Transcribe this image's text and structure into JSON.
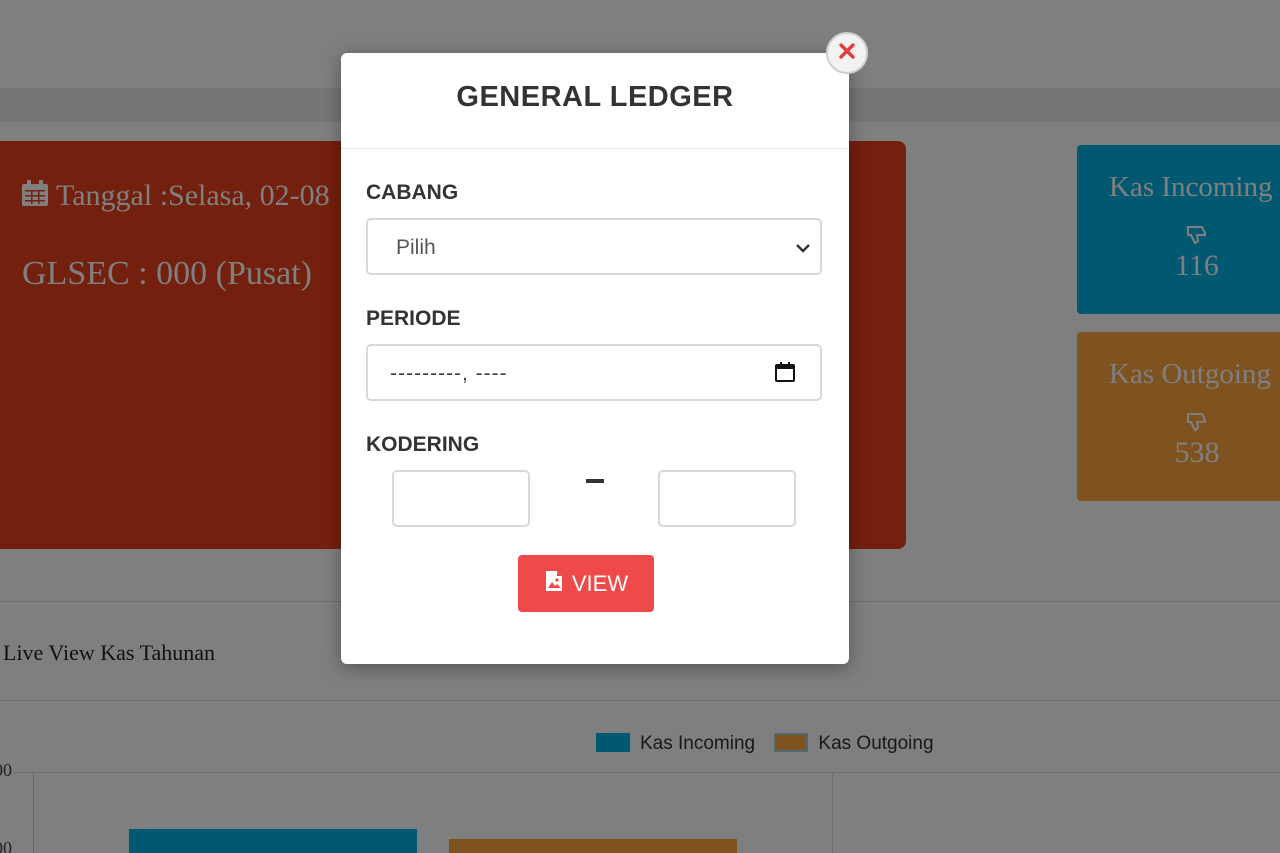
{
  "background": {
    "date_label": "Tanggal :Selasa, 02-08",
    "glsec_label": "GLSEC : 000 (Pusat)",
    "kas_incoming": {
      "title": "Kas Incoming",
      "value": "116"
    },
    "kas_outgoing": {
      "title": "Kas Outgoing",
      "value": "538"
    },
    "section_title": "Live View Kas Tahunan",
    "chart_data": {
      "type": "bar",
      "series": [
        {
          "name": "Kas Incoming",
          "color": "#00b3e3"
        },
        {
          "name": "Kas Outgoing",
          "color": "#ffa640"
        }
      ],
      "y_tick_labels": [
        "00",
        "00"
      ]
    },
    "colors": {
      "main_card": "#e8401c",
      "incoming": "#00b3e3",
      "outgoing": "#ffa640"
    }
  },
  "modal": {
    "title": "GENERAL LEDGER",
    "cabang_label": "CABANG",
    "cabang_value": "Pilih",
    "periode_label": "PERIODE",
    "periode_value": "---------, ----",
    "kodering_label": "KODERING",
    "view_button_label": "VIEW",
    "close_icon": "close-icon",
    "colors": {
      "view_button": "#ee4a49",
      "close_x": "#e23c3c"
    }
  }
}
